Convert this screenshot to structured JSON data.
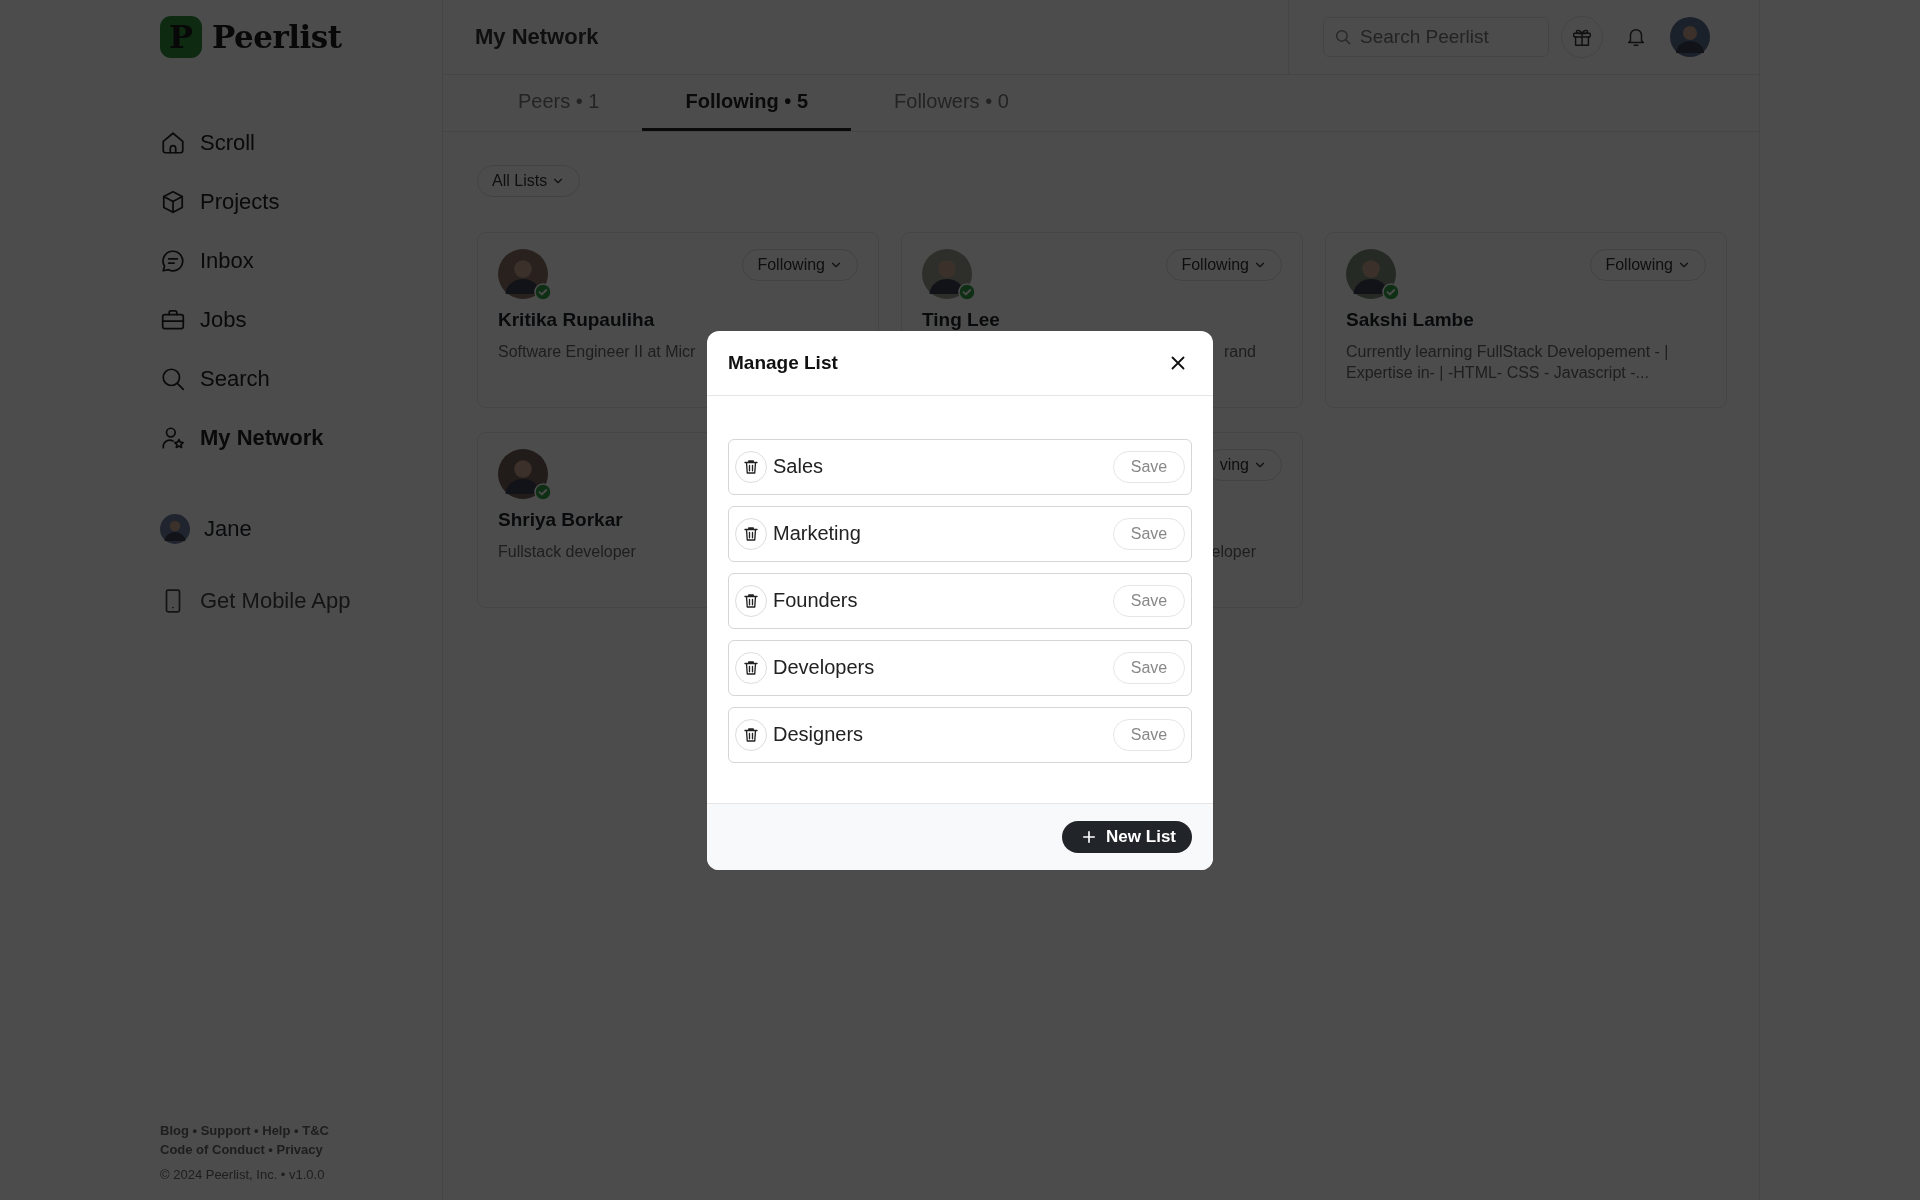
{
  "sidebar": {
    "logo_mark": "P",
    "logo": "Peerlist",
    "nav": [
      {
        "label": "Scroll",
        "selected": false
      },
      {
        "label": "Projects",
        "selected": false
      },
      {
        "label": "Inbox",
        "selected": false
      },
      {
        "label": "Jobs",
        "selected": false
      },
      {
        "label": "Search",
        "selected": false
      },
      {
        "label": "My Network",
        "selected": true
      }
    ],
    "profile": "Jane",
    "mobile_app": "Get Mobile App",
    "footer_links": [
      "Blog • Support • Help • T&C",
      "Code of Conduct • Privacy"
    ],
    "copyright": "© 2024 Peerlist, Inc. • v1.0.0"
  },
  "header": {
    "title": "My Network",
    "search_placeholder": "Search Peerlist"
  },
  "tabs": [
    {
      "label": "Peers • 1",
      "selected": false
    },
    {
      "label": "Following • 5",
      "selected": true
    },
    {
      "label": "Followers • 0",
      "selected": false
    }
  ],
  "filter": "All Lists",
  "cards": [
    {
      "verified": true,
      "name": "Kritika Rupauliha",
      "description": "Software Engineer II at Micr",
      "button": "Following"
    },
    {
      "verified": true,
      "name": "Ting Lee",
      "description": "rand",
      "kind": "fragment",
      "button": "Following"
    },
    {
      "verified": true,
      "name": "Sakshi Lambe",
      "description": "Currently learning FullStack Developement - | Expertise in- | -HTML- CSS - Javascript -...",
      "button": "Following"
    },
    {
      "verified": true,
      "name": "Shriya Borkar",
      "description": "Fullstack developer"
    },
    {
      "description": "eloper",
      "kind": "fragment",
      "button": "ving"
    }
  ],
  "modal": {
    "title": "Manage List",
    "lists": [
      {
        "name": "Sales",
        "button": "Save"
      },
      {
        "name": "Marketing",
        "button": "Save"
      },
      {
        "name": "Founders",
        "button": "Save"
      },
      {
        "name": "Developers",
        "button": "Save"
      },
      {
        "name": "Designers",
        "button": "Save"
      }
    ],
    "new_button": "New List"
  }
}
